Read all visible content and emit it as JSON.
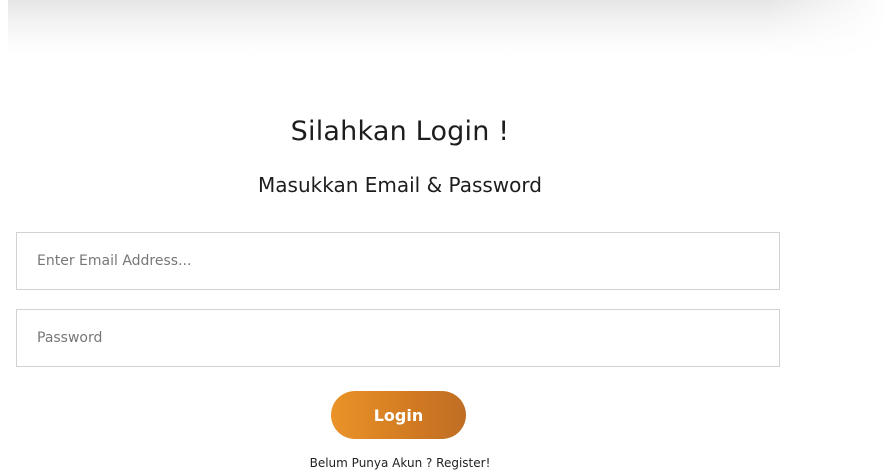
{
  "login": {
    "title": "Silahkan Login !",
    "subtitle": "Masukkan Email & Password",
    "email_placeholder": "Enter Email Address...",
    "password_placeholder": "Password",
    "login_label": "Login",
    "register_link": "Belum Punya Akun ? Register!"
  },
  "colors": {
    "button_gradient_start": "#ea9328",
    "button_gradient_end": "#c06e25",
    "button_text": "#ffffff",
    "field_border": "#d2d2d2"
  }
}
